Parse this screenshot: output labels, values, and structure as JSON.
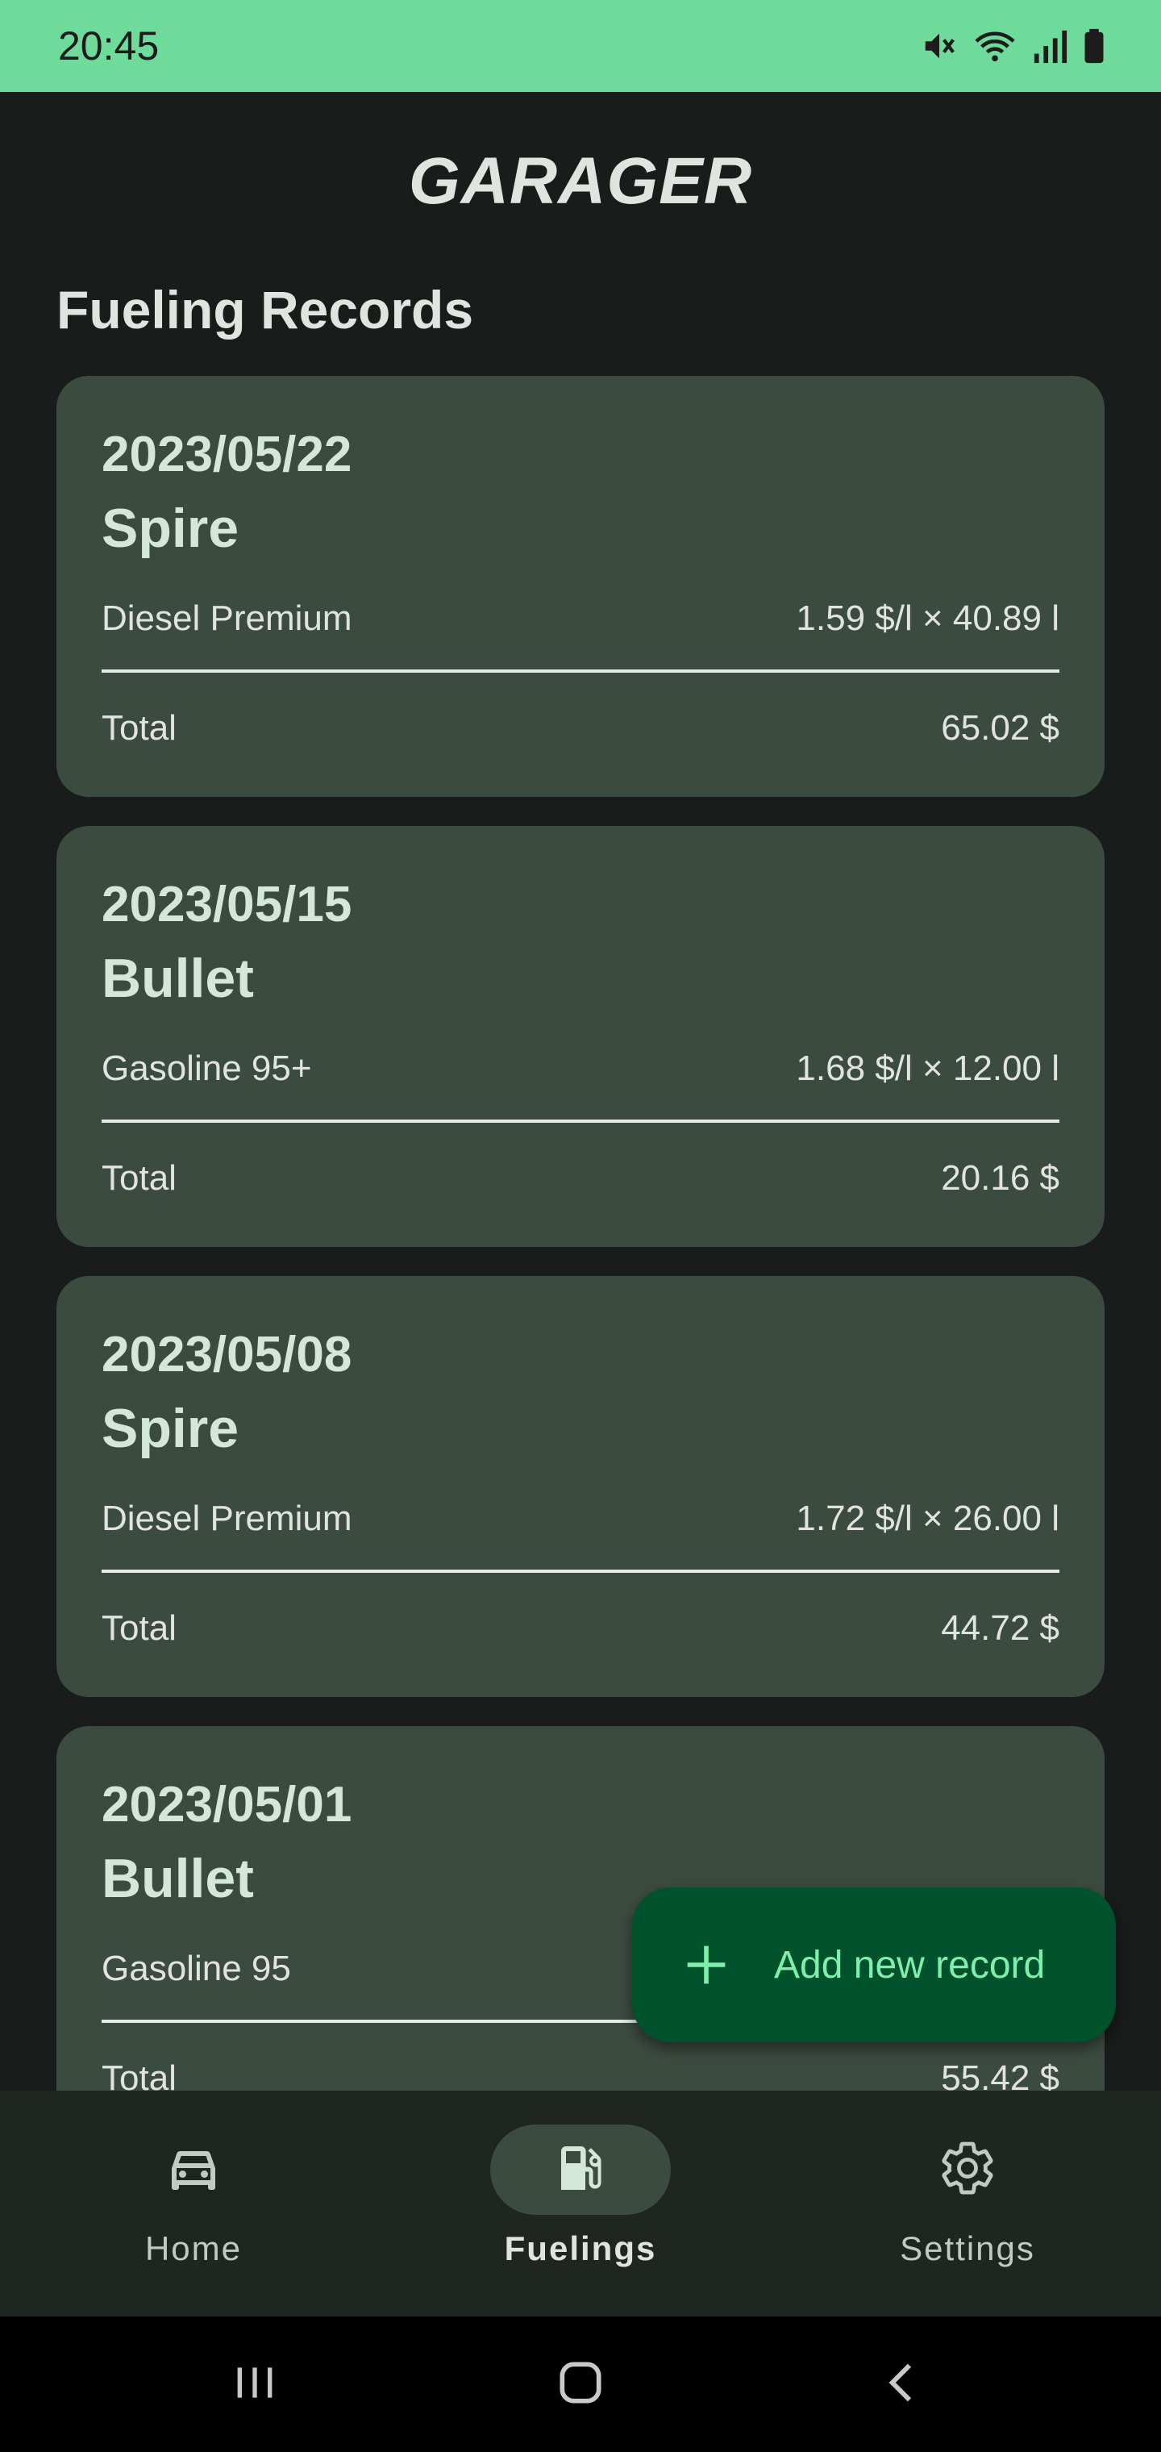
{
  "status_bar": {
    "time": "20:45",
    "icons": [
      "mute-icon",
      "wifi-icon",
      "signal-icon",
      "battery-icon"
    ]
  },
  "app": {
    "title": "GARAGER"
  },
  "section": {
    "title": "Fueling Records"
  },
  "records": [
    {
      "date": "2023/05/22",
      "vehicle": "Spire",
      "fuel_type": "Diesel Premium",
      "price_qty": "1.59 $/l × 40.89 l",
      "total_label": "Total",
      "total_value": "65.02 $"
    },
    {
      "date": "2023/05/15",
      "vehicle": "Bullet",
      "fuel_type": "Gasoline 95+",
      "price_qty": "1.68 $/l × 12.00 l",
      "total_label": "Total",
      "total_value": "20.16 $"
    },
    {
      "date": "2023/05/08",
      "vehicle": "Spire",
      "fuel_type": "Diesel Premium",
      "price_qty": "1.72 $/l × 26.00 l",
      "total_label": "Total",
      "total_value": "44.72 $"
    },
    {
      "date": "2023/05/01",
      "vehicle": "Bullet",
      "fuel_type": "Gasoline 95",
      "price_qty": "",
      "total_label": "Total",
      "total_value": "55.42 $"
    }
  ],
  "fab": {
    "label": "Add new record",
    "icon": "plus-icon"
  },
  "bottom_nav": {
    "items": [
      {
        "label": "Home",
        "icon": "car-icon",
        "active": false
      },
      {
        "label": "Fuelings",
        "icon": "fuel-pump-icon",
        "active": true
      },
      {
        "label": "Settings",
        "icon": "gear-icon",
        "active": false
      }
    ]
  },
  "system_nav": {
    "buttons": [
      "recents-icon",
      "home-icon",
      "back-icon"
    ]
  },
  "colors": {
    "status_bar": "#6fdb9a",
    "background": "#191c1a",
    "card": "#3c4b40",
    "fab": "#00522d",
    "fab_text": "#7ef0ab",
    "nav_bar": "#1f2621"
  }
}
